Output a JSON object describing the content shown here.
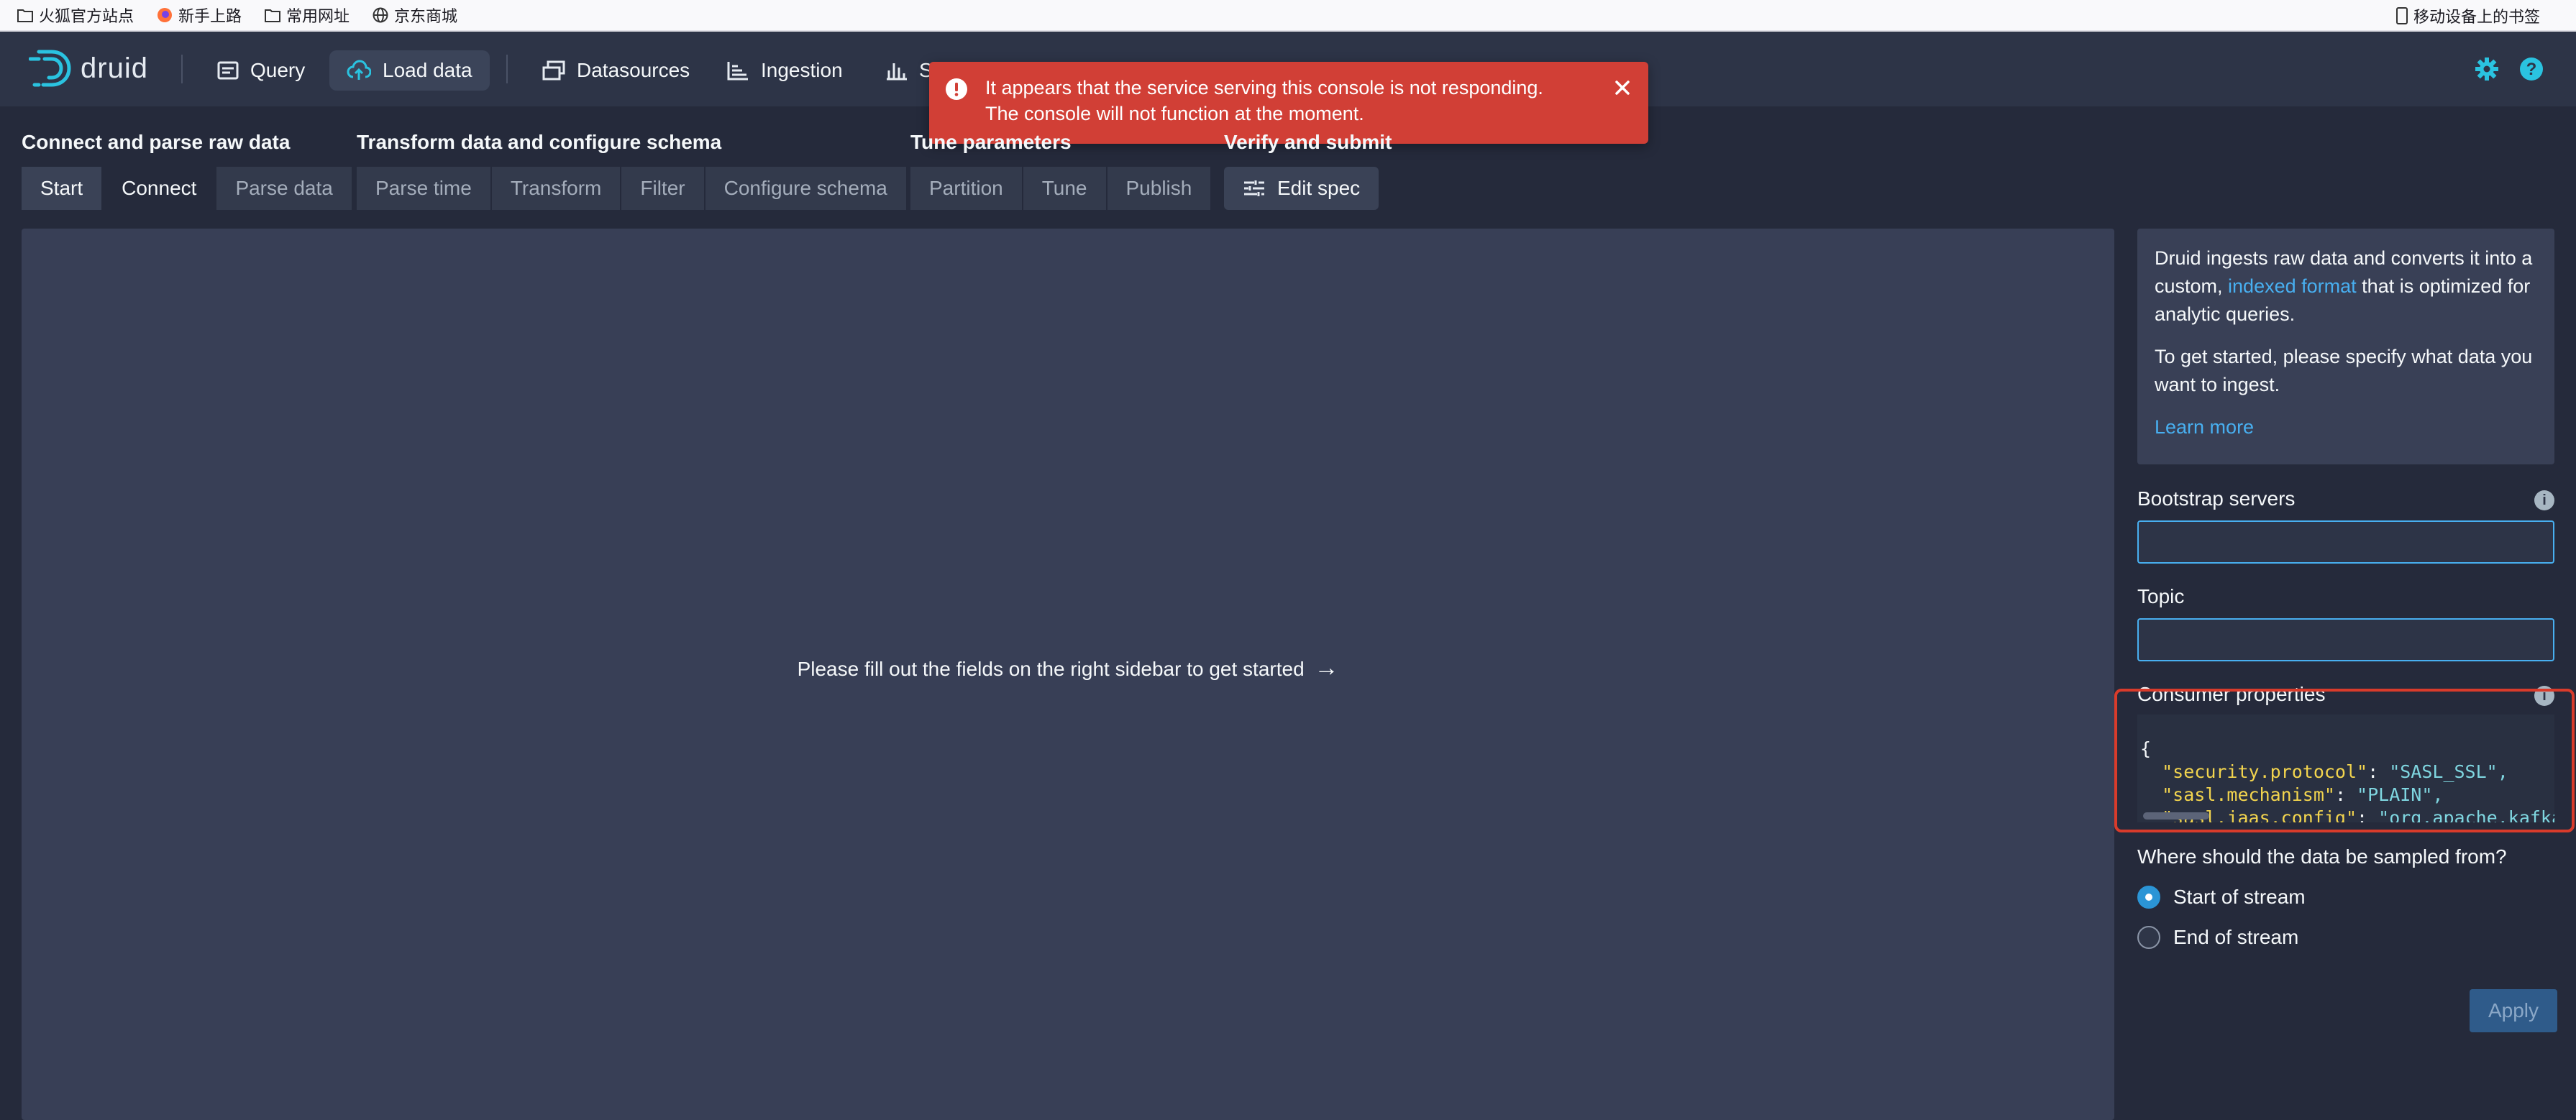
{
  "browser": {
    "bookmarks": [
      {
        "label": "火狐官方站点",
        "icon": "folder-icon"
      },
      {
        "label": "新手上路",
        "icon": "firefox-icon"
      },
      {
        "label": "常用网址",
        "icon": "folder-icon"
      },
      {
        "label": "京东商城",
        "icon": "globe-icon"
      }
    ],
    "mobile_bookmarks": "移动设备上的书签"
  },
  "nav": {
    "brand": "druid",
    "items": [
      {
        "label": "Query",
        "icon": "query-icon",
        "active": false
      },
      {
        "label": "Load data",
        "icon": "cloud-upload-icon",
        "active": true
      },
      {
        "label": "Datasources",
        "icon": "datasources-icon",
        "active": false
      },
      {
        "label": "Ingestion",
        "icon": "ingestion-icon",
        "active": false
      },
      {
        "label": "S",
        "icon": "segments-icon",
        "active": false
      }
    ],
    "right_icons": [
      "gear-icon",
      "help-icon"
    ]
  },
  "toast": {
    "line1": "It appears that the service serving this console is not responding.",
    "line2": "The console will not function at the moment.",
    "color": "#d13f36"
  },
  "steps": [
    {
      "title": "Connect and parse raw data",
      "tabs": [
        "Start",
        "Connect",
        "Parse data"
      ]
    },
    {
      "title": "Transform data and configure schema",
      "tabs": [
        "Parse time",
        "Transform",
        "Filter",
        "Configure schema"
      ]
    },
    {
      "title": "Tune parameters",
      "tabs": [
        "Partition",
        "Tune",
        "Publish"
      ]
    },
    {
      "title": "Verify and submit",
      "tabs": [
        "Edit spec"
      ]
    }
  ],
  "current_step": "Connect",
  "main": {
    "message": "Please fill out the fields on the right sidebar to get started",
    "arrow": "→"
  },
  "sidebar": {
    "intro_pre": "Druid ingests raw data and converts it into a custom,",
    "intro_link": "indexed format",
    "intro_post": "that is optimized for analytic queries.",
    "intro2": "To get started, please specify what data you want to ingest.",
    "learn_more": "Learn more",
    "bootstrap_label": "Bootstrap servers",
    "bootstrap_value": "",
    "topic_label": "Topic",
    "topic_value": "",
    "consumer_label": "Consumer properties",
    "consumer_lines": [
      {
        "key": "\"security.protocol\"",
        "value": "\"SASL_SSL\","
      },
      {
        "key": "\"sasl.mechanism\"",
        "value": "\"PLAIN\","
      },
      {
        "key": "\"sasl.jaas.config\"",
        "value": "\"org.apache.kafka."
      }
    ],
    "brace_open": "{",
    "brace_close": "}",
    "sample_question": "Where should the data be sampled from?",
    "sample_options": [
      {
        "label": "Start of stream",
        "checked": true
      },
      {
        "label": "End of stream",
        "checked": false
      }
    ],
    "apply": "Apply",
    "info_mark": "i"
  },
  "colors": {
    "accent": "#48aff0",
    "highlight_box": "#d93b2b",
    "background": "#252a3b",
    "navbar": "#2d3447"
  }
}
